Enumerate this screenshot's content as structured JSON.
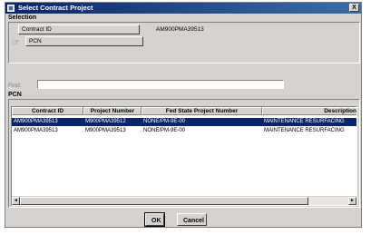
{
  "window": {
    "title": "Select Contract Project",
    "close_glyph": "X"
  },
  "selection": {
    "heading": "Selection",
    "contract_id_label": "Contract ID",
    "contract_id_value": "AM900PMA39513",
    "pcn_label": "PCN"
  },
  "find": {
    "label": "Find:",
    "value": ""
  },
  "pcn": {
    "heading": "PCN",
    "columns": [
      "Contract ID",
      "Project Number",
      "Fed State Project Number",
      "Description"
    ],
    "rows": [
      [
        "AM900PMA39513",
        "M900PMA39512",
        "NONE/PM-9E-00",
        "MAINTENANCE RESURFACING"
      ],
      [
        "AM900PMA39513",
        "M900PMA39513",
        "NONE/PM-9E-00",
        "MAINTENANCE RESURFACING"
      ]
    ],
    "selected_row": 0
  },
  "scroll": {
    "left_glyph": "◄",
    "right_glyph": "►"
  },
  "buttons": {
    "ok": "OK",
    "cancel": "Cancel"
  },
  "icons": {
    "app": "window-icon",
    "hand": "hand-pointer-icon"
  }
}
